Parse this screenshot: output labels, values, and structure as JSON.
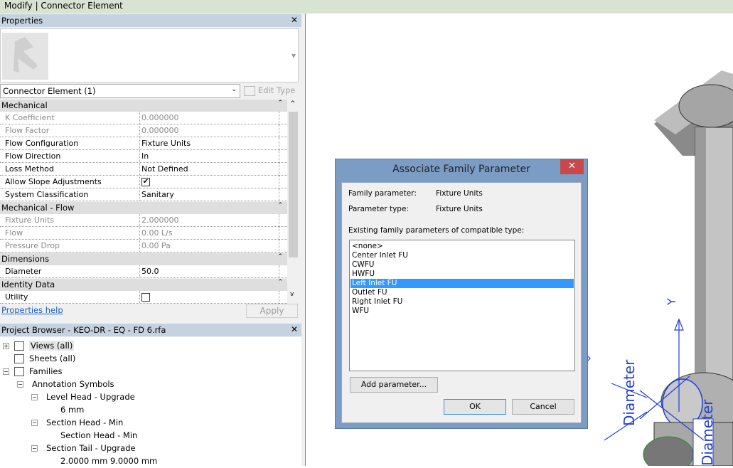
{
  "titlebar": {
    "title": "Modify | Connector Element"
  },
  "properties": {
    "header": "Properties",
    "close": "✕",
    "type_selector": "Connector Element (1)",
    "edit_type": "Edit Type",
    "groups": [
      {
        "name": "Mechanical",
        "rows": [
          {
            "key": "K Coefficient",
            "value": "0.000000",
            "disabled": true
          },
          {
            "key": "Flow Factor",
            "value": "0.000000",
            "disabled": true
          },
          {
            "key": "Flow Configuration",
            "value": "Fixture Units"
          },
          {
            "key": "Flow Direction",
            "value": "In"
          },
          {
            "key": "Loss Method",
            "value": "Not Defined"
          },
          {
            "key": "Allow Slope Adjustments",
            "value": "",
            "checkbox": true,
            "checked": true
          },
          {
            "key": "System Classification",
            "value": "Sanitary"
          }
        ]
      },
      {
        "name": "Mechanical - Flow",
        "rows": [
          {
            "key": "Fixture Units",
            "value": "2.000000",
            "disabled": true
          },
          {
            "key": "Flow",
            "value": "0.00 L/s",
            "disabled": true
          },
          {
            "key": "Pressure Drop",
            "value": "0.00 Pa",
            "disabled": true
          }
        ]
      },
      {
        "name": "Dimensions",
        "rows": [
          {
            "key": "Diameter",
            "value": "50.0"
          }
        ]
      },
      {
        "name": "Identity Data",
        "rows": [
          {
            "key": "Utility",
            "value": "",
            "checkbox": true,
            "checked": false
          }
        ]
      }
    ],
    "help_link": "Properties help",
    "apply": "Apply"
  },
  "project_browser": {
    "header": "Project Browser - KEO-DR - EQ - FD 6.rfa",
    "close": "✕",
    "items": [
      {
        "label": "Views (all)",
        "level": 0,
        "toggle": "+",
        "icon": "views-icon"
      },
      {
        "label": "Sheets (all)",
        "level": 0,
        "icon": "sheets-icon"
      },
      {
        "label": "Families",
        "level": 0,
        "toggle": "-",
        "icon": "families-icon"
      },
      {
        "label": "Annotation Symbols",
        "level": 1,
        "toggle": "-"
      },
      {
        "label": "Level Head - Upgrade",
        "level": 2,
        "toggle": "-"
      },
      {
        "label": "6 mm",
        "level": 3
      },
      {
        "label": "Section Head - Min",
        "level": 2,
        "toggle": "-"
      },
      {
        "label": "Section Head - Min",
        "level": 3
      },
      {
        "label": "Section Tail - Upgrade",
        "level": 2,
        "toggle": "-"
      },
      {
        "label": "2.0000 mm 9.0000 mm",
        "level": 3
      }
    ]
  },
  "dialog": {
    "title": "Associate Family Parameter",
    "close": "✕",
    "family_parameter_label": "Family parameter:",
    "family_parameter_value": "Fixture Units",
    "parameter_type_label": "Parameter type:",
    "parameter_type_value": "Fixture Units",
    "list_label": "Existing family parameters of compatible type:",
    "options": [
      "<none>",
      "Center Inlet FU",
      "CWFU",
      "HWFU",
      "Left Inlet FU",
      "Outlet FU",
      "Right Inlet FU",
      "WFU"
    ],
    "selected": "Left Inlet FU",
    "add_parameter": "Add parameter...",
    "ok": "OK",
    "cancel": "Cancel"
  },
  "viewport": {
    "labels": {
      "diameter1": "Diameter",
      "diameter2": "Diameter",
      "axis": "Y"
    }
  },
  "colors": {
    "accent": "#3399ff",
    "dim_blue": "#1f3fd8",
    "close_red": "#c9494a"
  }
}
